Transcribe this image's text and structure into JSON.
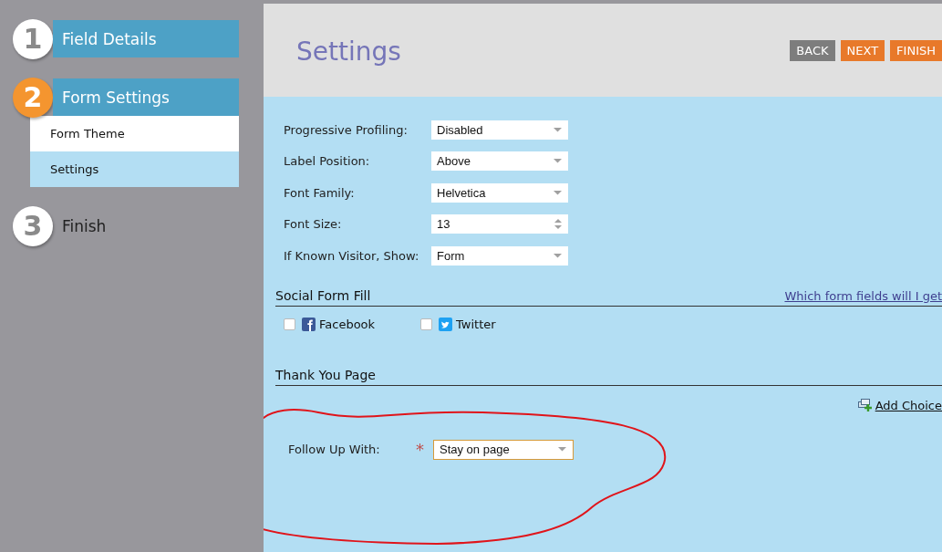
{
  "steps": [
    {
      "number": "1",
      "label": "Field Details",
      "completed": true,
      "current": false
    },
    {
      "number": "2",
      "label": "Form Settings",
      "completed": false,
      "current": true,
      "substeps": [
        {
          "label": "Form Theme",
          "selected": false
        },
        {
          "label": "Settings",
          "selected": true
        }
      ]
    },
    {
      "number": "3",
      "label": "Finish",
      "completed": false,
      "current": false
    }
  ],
  "header": {
    "title": "Settings",
    "buttons": [
      {
        "label": "BACK",
        "kind": "secondary"
      },
      {
        "label": "NEXT",
        "kind": "primary"
      },
      {
        "label": "FINISH",
        "kind": "primary"
      }
    ]
  },
  "settings": [
    {
      "label": "Progressive Profiling:",
      "value": "Disabled",
      "kind": "select"
    },
    {
      "label": "Label Position:",
      "value": "Above",
      "kind": "select"
    },
    {
      "label": "Font Family:",
      "value": "Helvetica",
      "kind": "select"
    },
    {
      "label": "Font Size:",
      "value": "13",
      "kind": "number"
    },
    {
      "label": "If Known Visitor, Show:",
      "value": "Form",
      "kind": "select"
    }
  ],
  "social_form_fill": {
    "title": "Social Form Fill",
    "link": "Which form fields will I get",
    "options": [
      {
        "label": "Facebook",
        "checked": false,
        "kind": "facebook"
      },
      {
        "label": "Twitter",
        "checked": false,
        "kind": "twitter"
      }
    ]
  },
  "thank_you_page": {
    "title": "Thank You Page",
    "add_choice": "Add Choice",
    "follow_up": {
      "label": "Follow Up With:",
      "required_mark": "*",
      "value": "Stay on page",
      "focused": true
    }
  }
}
